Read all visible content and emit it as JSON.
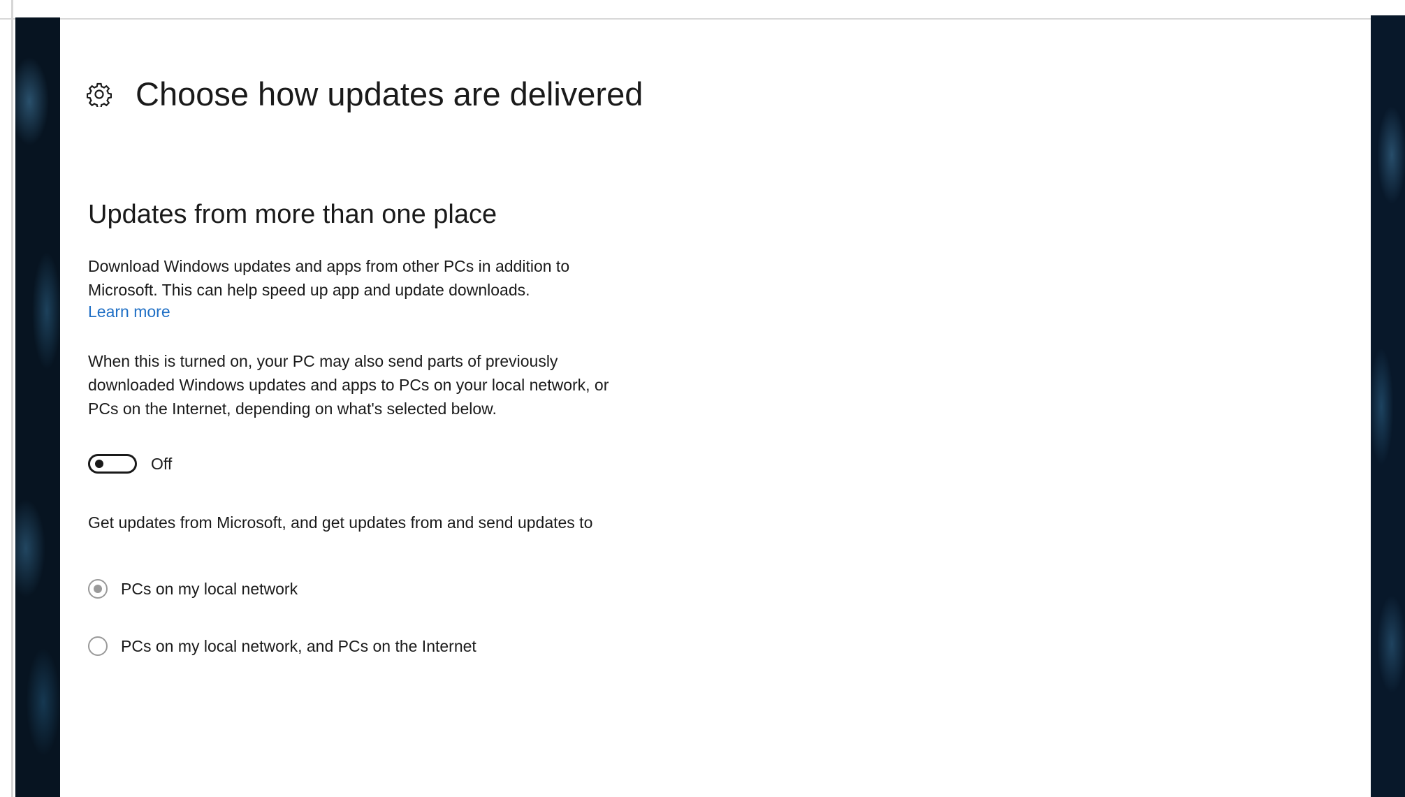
{
  "header": {
    "title": "Choose how updates are delivered",
    "icon": "gear-icon"
  },
  "section": {
    "heading": "Updates from more than one place",
    "description": "Download Windows updates and apps from other PCs in addition to Microsoft. This can help speed up app and update downloads.",
    "learn_more": "Learn more",
    "sharing_note": "When this is turned on, your PC may also send parts of previously downloaded Windows updates and apps to PCs on your local network, or PCs on the Internet, depending on what's selected below."
  },
  "toggle": {
    "state": "off",
    "label": "Off"
  },
  "options": {
    "prompt": "Get updates from Microsoft, and get updates from and send updates to",
    "selected_index": 0,
    "items": [
      {
        "label": "PCs on my local network"
      },
      {
        "label": "PCs on my local network, and PCs on the Internet"
      }
    ]
  },
  "colors": {
    "link": "#1f6fc5",
    "text": "#1a1a1a",
    "desktop": "#071421"
  }
}
